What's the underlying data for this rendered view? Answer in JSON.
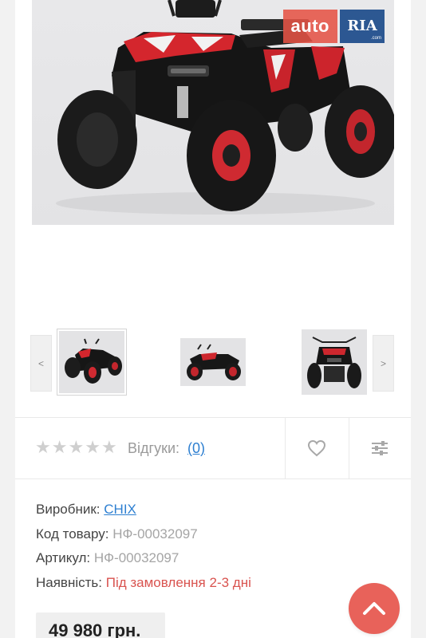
{
  "product": {
    "watermark": {
      "auto_text": "auto",
      "ria_text": "RIA",
      "ria_domain": ".com"
    }
  },
  "gallery": {
    "prev_label": "<",
    "next_label": ">",
    "thumbnails": [
      "ATV front-left view",
      "ATV side view",
      "ATV front view"
    ]
  },
  "rating": {
    "stars_filled": 0,
    "stars_total": 5,
    "star_glyph": "★",
    "reviews_label": "Відгуки:",
    "reviews_count": "(0)"
  },
  "actions": {
    "favorite_icon": "heart-icon",
    "compare_icon": "sliders-icon"
  },
  "details": {
    "manufacturer_label": "Виробник:",
    "manufacturer_value": "CHIX",
    "code_label": "Код товару:",
    "code_value": "НФ-00032097",
    "article_label": "Артикул:",
    "article_value": "НФ-00032097",
    "availability_label": "Наявність:",
    "availability_value": "Під замовлення 2-3 дні"
  },
  "price": {
    "value": "49 980 грн."
  },
  "colors": {
    "accent_red": "#e8625a",
    "link_blue": "#2d7fd1",
    "availability_red": "#d9534f",
    "star_grey": "#cfcfcf"
  }
}
